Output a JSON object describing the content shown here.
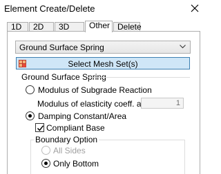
{
  "window": {
    "title": "Element Create/Delete"
  },
  "tabs": [
    {
      "label": "1D",
      "active": false
    },
    {
      "label": "2D",
      "active": false
    },
    {
      "label": "3D",
      "active": false
    },
    {
      "label": "Other",
      "active": true
    },
    {
      "label": "Delete",
      "active": false
    }
  ],
  "type_select": {
    "value": "Ground Surface Spring"
  },
  "mesh_button": {
    "label": "Select Mesh Set(s)",
    "icon": "mesh-set-icon"
  },
  "ground_spring": {
    "group_label": "Ground Surface Spring",
    "modulus_option": {
      "label": "Modulus of Subgrade Reaction",
      "checked": false
    },
    "elasticity": {
      "label": "Modulus of elasticity coeff. a",
      "value": "1"
    },
    "damping_option": {
      "label": "Damping Constant/Area",
      "checked": true
    },
    "compliant_base": {
      "label": "Compliant Base",
      "checked": true
    },
    "boundary": {
      "group_label": "Boundary Option",
      "all_sides": {
        "label": "All Sides",
        "checked": false,
        "enabled": false
      },
      "only_bottom": {
        "label": "Only Bottom",
        "checked": true
      }
    }
  },
  "colors": {
    "button_bg": "#cfe6f7",
    "button_border": "#3c7fb1",
    "disabled_text": "#a0a0a0"
  }
}
